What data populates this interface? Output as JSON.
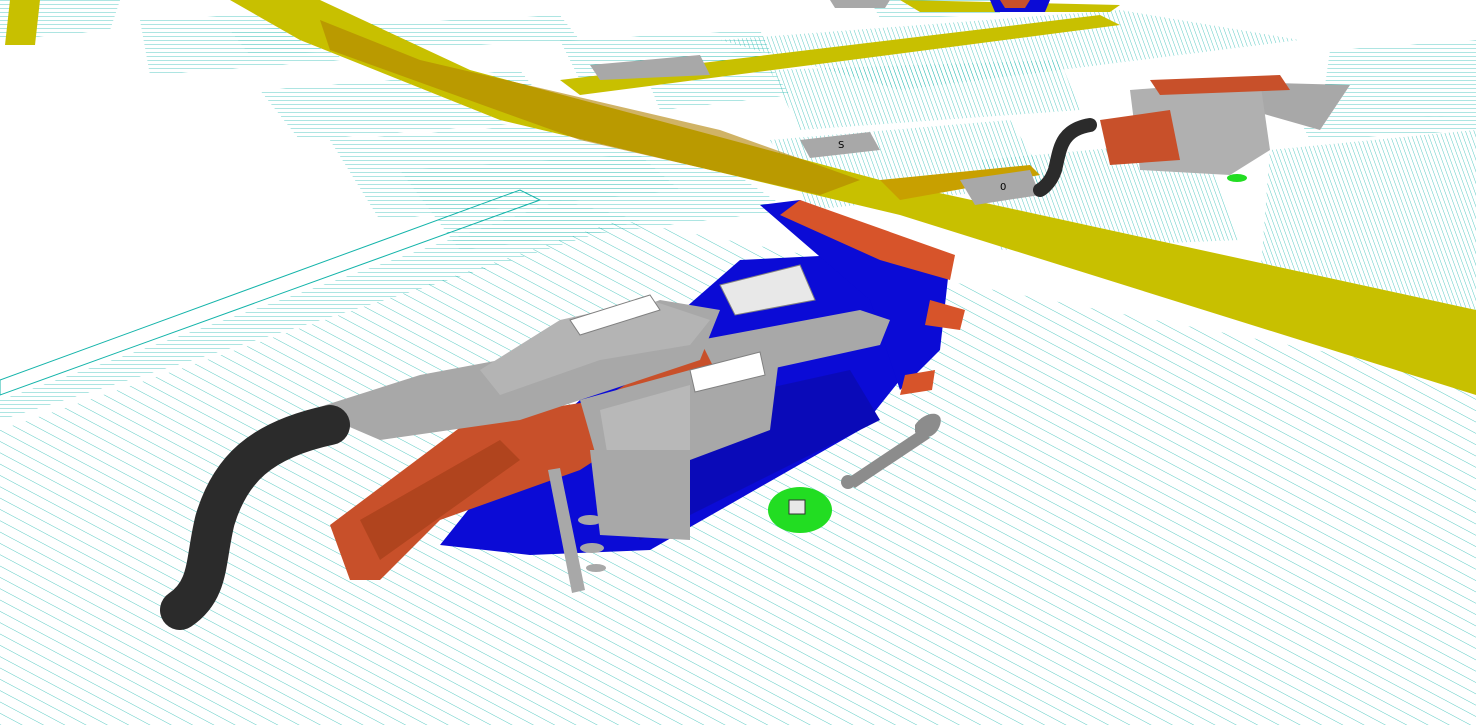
{
  "viewport": {
    "background": "#ffffff",
    "grid_line_color": "#14b4aa",
    "walkway_color": "#c8c000"
  },
  "scene": {
    "floor_markers": [
      {
        "id": "marker-a",
        "text": "0"
      },
      {
        "id": "marker-b",
        "text": "S"
      }
    ],
    "machines": [
      {
        "id": "machine-foreground",
        "colors": {
          "frame": "#0b0bd6",
          "chute": "#c8502a",
          "conveyor": "#d7542a",
          "hood": "#a8a8a8",
          "hose": "#2b2b2b"
        },
        "parts": [
          "base-frame",
          "discharge-chute",
          "intake-hood",
          "drive-shaft",
          "control-box",
          "feed-conveyor",
          "flexible-hose",
          "support-post"
        ]
      },
      {
        "id": "machine-background",
        "colors": {
          "frame": "#a8a8a8",
          "chute": "#c8502a",
          "hose": "#2b2b2b"
        },
        "parts": [
          "base-frame",
          "discharge-chute",
          "flexible-hose"
        ]
      }
    ],
    "tools": [
      {
        "id": "wrench",
        "color": "#8c8c8c"
      }
    ],
    "status_disc": {
      "color": "#22dd22"
    }
  }
}
